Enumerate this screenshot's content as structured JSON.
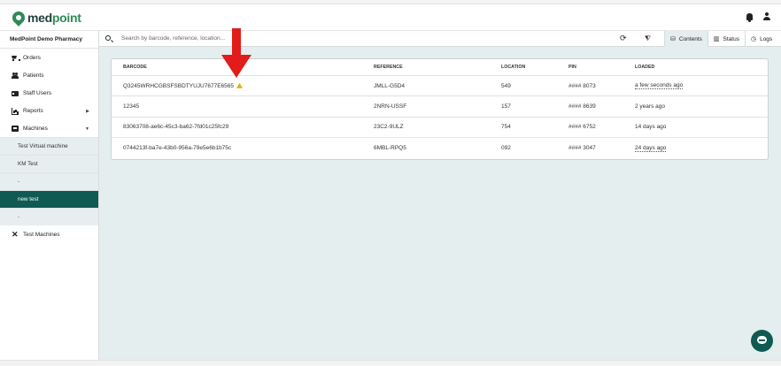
{
  "app": {
    "logo_part1": "med",
    "logo_part2": "point",
    "pharmacy_name": "MedPoint Demo Pharmacy"
  },
  "sidebar": {
    "items": [
      {
        "label": "Orders",
        "icon": "cart-icon"
      },
      {
        "label": "Patients",
        "icon": "users-icon"
      },
      {
        "label": "Staff Users",
        "icon": "id-card-icon"
      },
      {
        "label": "Reports",
        "icon": "chart-icon",
        "expandable": true
      },
      {
        "label": "Machines",
        "icon": "machine-icon",
        "expanded": true
      }
    ],
    "machines": [
      {
        "label": "Test Virtual machine",
        "active": false
      },
      {
        "label": "KM Test",
        "active": false
      },
      {
        "label": "-",
        "active": false
      },
      {
        "label": "new test",
        "active": true
      },
      {
        "label": "-",
        "active": false
      }
    ],
    "test_machines_label": "Test Machines"
  },
  "search": {
    "placeholder": "Search by barcode, reference, location..."
  },
  "tabs": [
    {
      "label": "Contents",
      "icon": "cylinder-icon",
      "active": true
    },
    {
      "label": "Status",
      "icon": "status-chart-icon",
      "active": false
    },
    {
      "label": "Logs",
      "icon": "clock-icon",
      "active": false
    }
  ],
  "table": {
    "headers": [
      "BARCODE",
      "REFERENCE",
      "LOCATION",
      "PIN",
      "LOADED"
    ],
    "rows": [
      {
        "barcode": "Q3245WRHCGBSFSBDTYUJU7677E6565",
        "warning": true,
        "reference": "JMLL-G5D4",
        "location": "549",
        "pin": "#### 8073",
        "loaded": "a few seconds ago",
        "loaded_dotted": true
      },
      {
        "barcode": "12345",
        "warning": false,
        "reference": "2NRN-USSF",
        "location": "157",
        "pin": "#### 8639",
        "loaded": "2 years ago",
        "loaded_dotted": false
      },
      {
        "barcode": "83063708-ae6c-45c3-ba62-7fd01c25fc29",
        "warning": false,
        "reference": "23C2-9ULZ",
        "location": "754",
        "pin": "#### 6752",
        "loaded": "14 days ago",
        "loaded_dotted": false
      },
      {
        "barcode": "0744213f-ba7e-43b0-956a-79e5e6b1b75c",
        "warning": false,
        "reference": "6MBL-RPQ5",
        "location": "092",
        "pin": "#### 3047",
        "loaded": "24 days ago",
        "loaded_dotted": true
      }
    ]
  },
  "colors": {
    "brand_dark": "#0f5a52",
    "brand_green": "#2e8b57",
    "annotation_red": "#e21b1b",
    "warning": "#e4b400"
  }
}
